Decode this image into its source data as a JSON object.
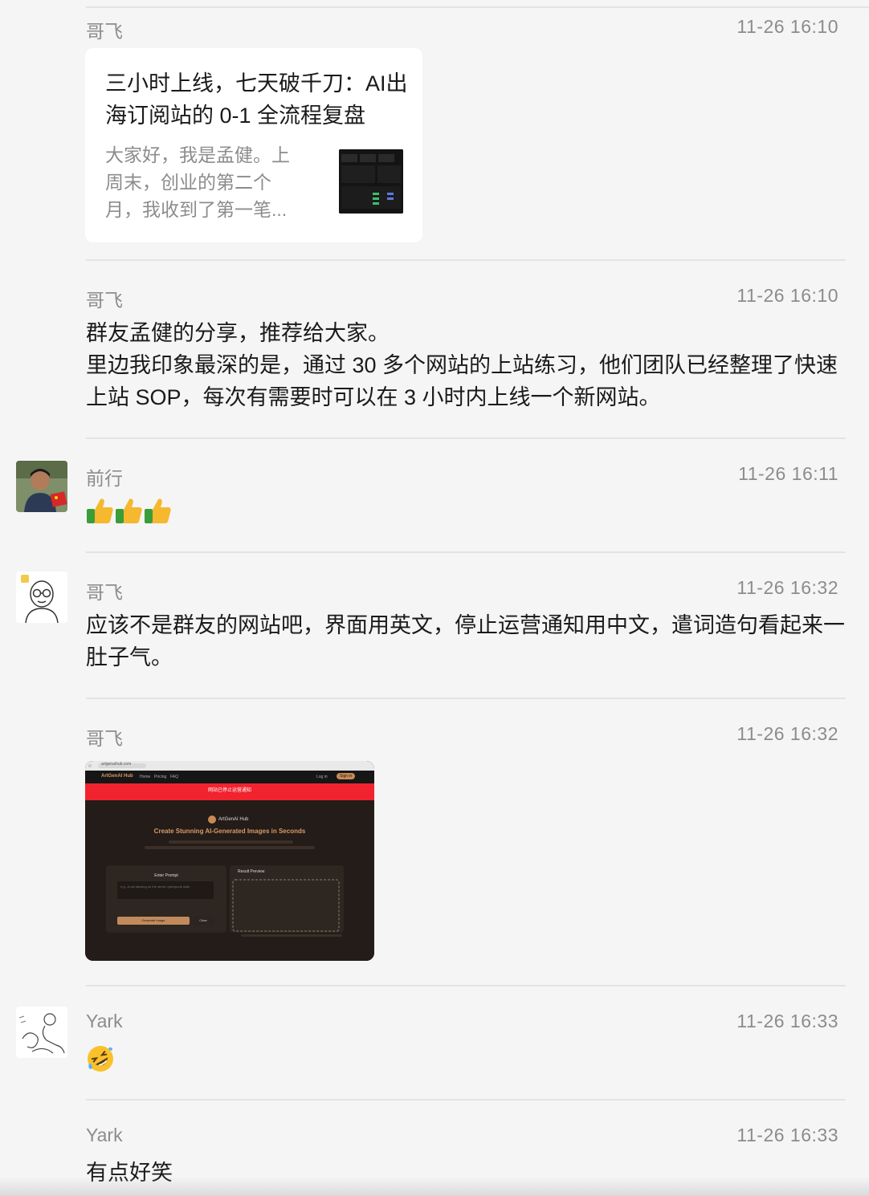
{
  "messages": [
    {
      "sender": "哥飞",
      "time": "11-26 16:10",
      "type": "link-card",
      "card": {
        "title": "三小时上线，七天破千刀：AI出海订阅站的 0-1 全流程复盘",
        "description": "大家好，我是孟健。上周末，创业的第二个月，我收到了第一笔..."
      }
    },
    {
      "sender": "哥飞",
      "time": "11-26 16:10",
      "type": "text",
      "text": "群友孟健的分享，推荐给大家。\n里边我印象最深的是，通过 30 多个网站的上站练习，他们团队已经整理了快速上站 SOP，每次有需要时可以在 3 小时内上线一个新网站。"
    },
    {
      "sender": "前行",
      "time": "11-26 16:11",
      "type": "emoji",
      "emoji": "thumbs-up x3"
    },
    {
      "sender": "哥飞",
      "time": "11-26 16:32",
      "type": "text",
      "text": "应该不是群友的网站吧，界面用英文，停止运营通知用中文，遣词造句看起来一肚子气。"
    },
    {
      "sender": "哥飞",
      "time": "11-26 16:32",
      "type": "image",
      "screenshot": {
        "url": "artgenaihub.com",
        "brand": "ArtGenAI Hub",
        "nav": [
          "Home",
          "Pricing",
          "FAQ"
        ],
        "login": "Log in",
        "signup": "Sign in",
        "banner_title": "网站已停止运营通知",
        "hero_brand": "ArtGenAI Hub",
        "hero_title": "Create Stunning AI-Generated Images in Seconds",
        "prompt_label": "Enter Prompt",
        "prompt_placeholder": "e.g., A cat dancing on the street, cyberpunk style",
        "generate": "Generate Image",
        "clear": "Clear",
        "result_label": "Result Preview"
      }
    },
    {
      "sender": "Yark",
      "time": "11-26 16:33",
      "type": "emoji",
      "emoji": "rolling-on-floor-laughing"
    },
    {
      "sender": "Yark",
      "time": "11-26 16:33",
      "type": "text",
      "text": "有点好笑"
    }
  ],
  "colors": {
    "background": "#f5f5f5",
    "meta_text": "#8c8c8c",
    "divider": "#e3e3e3",
    "card_bg": "#ffffff"
  }
}
